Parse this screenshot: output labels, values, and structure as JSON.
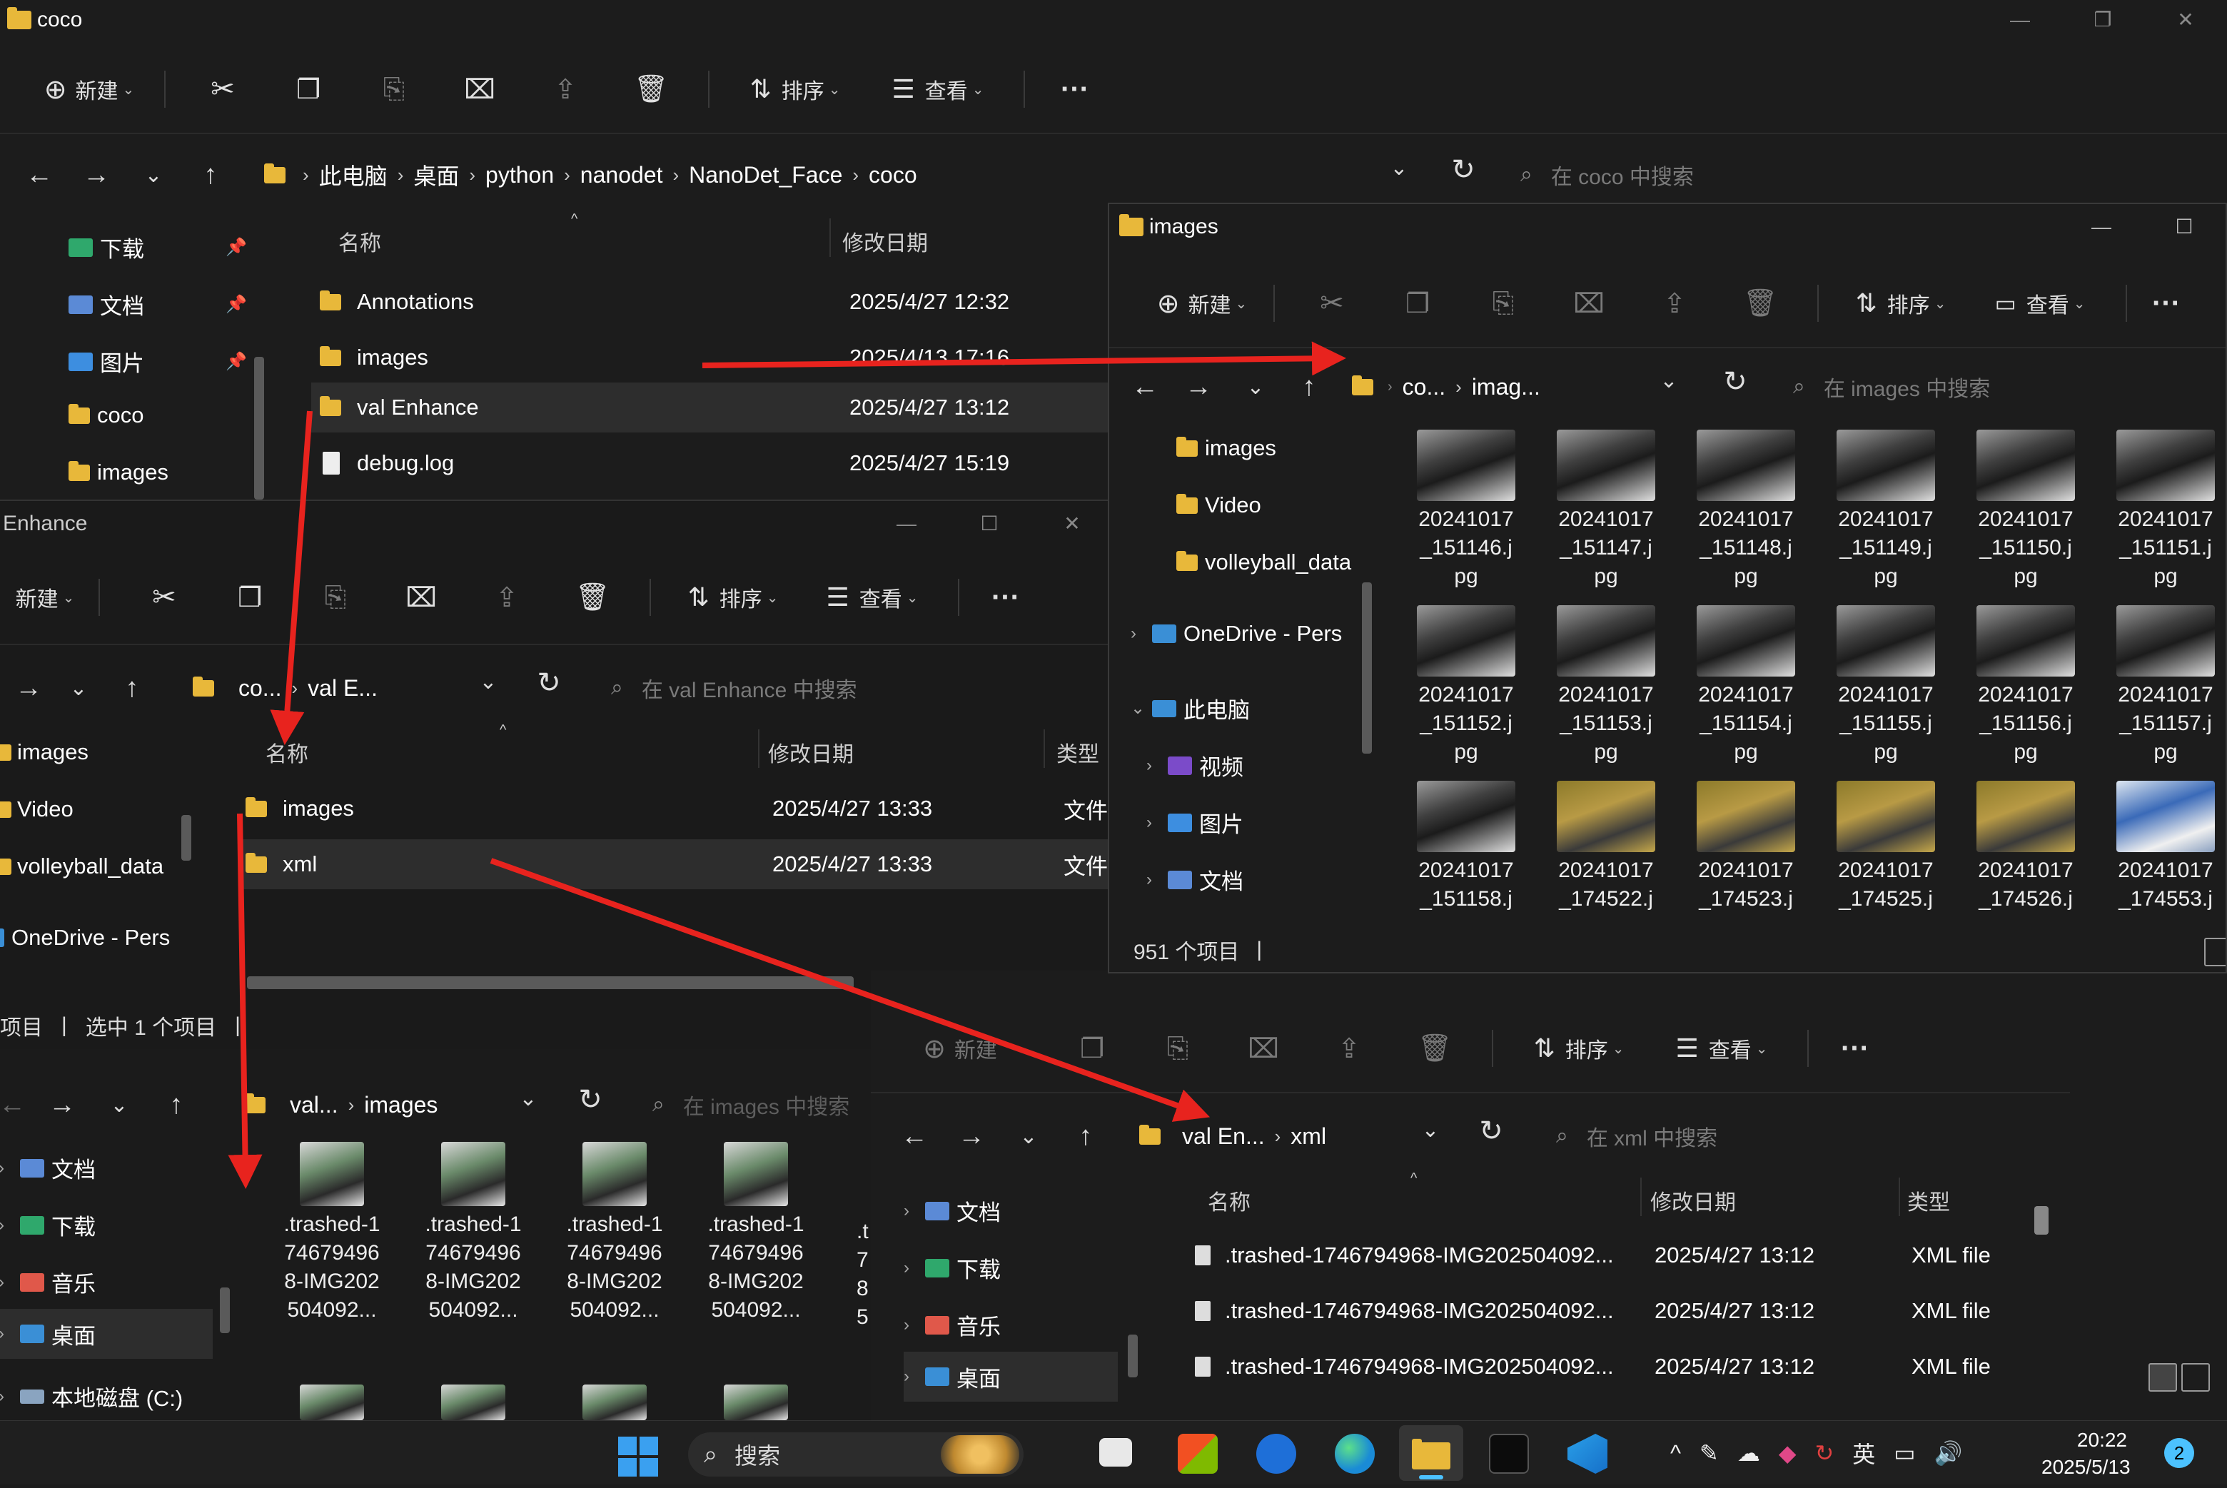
{
  "main_window": {
    "title": "coco",
    "toolbar": {
      "new": "新建",
      "sort": "排序",
      "view": "查看",
      "more": "···"
    },
    "breadcrumb": [
      "此电脑",
      "桌面",
      "python",
      "nanodet",
      "NanoDet_Face",
      "coco"
    ],
    "search_placeholder": "在 coco 中搜索",
    "nav": [
      {
        "label": "下载",
        "pinned": true
      },
      {
        "label": "文档",
        "pinned": true
      },
      {
        "label": "图片",
        "pinned": true
      },
      {
        "label": "coco"
      },
      {
        "label": "images"
      }
    ],
    "columns": {
      "name": "名称",
      "date": "修改日期"
    },
    "files": [
      {
        "name": "Annotations",
        "date": "2025/4/27 12:32",
        "type": "folder"
      },
      {
        "name": "images",
        "date": "2025/4/13 17:16",
        "type": "folder"
      },
      {
        "name": "val Enhance",
        "date": "2025/4/27 13:12",
        "type": "folder",
        "selected": true
      },
      {
        "name": "debug.log",
        "date": "2025/4/27 15:19",
        "type": "file"
      }
    ]
  },
  "enhance_window": {
    "title": "Enhance",
    "toolbar": {
      "new": "新建",
      "sort": "排序",
      "view": "查看",
      "more": "···"
    },
    "breadcrumb": [
      "co...",
      "val E..."
    ],
    "search_placeholder": "在 val Enhance 中搜索",
    "nav": [
      "images",
      "Video",
      "volleyball_data",
      "OneDrive - Pers"
    ],
    "columns": {
      "name": "名称",
      "date": "修改日期",
      "type": "类型"
    },
    "files": [
      {
        "name": "images",
        "date": "2025/4/27 13:33",
        "type": "文件"
      },
      {
        "name": "xml",
        "date": "2025/4/27 13:33",
        "type": "文件",
        "selected": true
      }
    ],
    "status": {
      "items": "项目",
      "selected": "选中 1 个项目"
    }
  },
  "images_window": {
    "title": "images",
    "toolbar": {
      "new": "新建",
      "sort": "排序",
      "view": "查看",
      "more": "···"
    },
    "breadcrumb": [
      "co...",
      "imag..."
    ],
    "search_placeholder": "在 images 中搜索",
    "nav": [
      {
        "label": "images",
        "indent": 1
      },
      {
        "label": "Video",
        "indent": 1
      },
      {
        "label": "volleyball_data",
        "indent": 1
      },
      {
        "label": "OneDrive - Pers",
        "indent": 0,
        "expander": "›"
      },
      {
        "label": "此电脑",
        "indent": 0,
        "expander": "⌄"
      },
      {
        "label": "视频",
        "indent": 1,
        "expander": "›"
      },
      {
        "label": "图片",
        "indent": 1,
        "expander": "›"
      },
      {
        "label": "文档",
        "indent": 1,
        "expander": "›"
      }
    ],
    "thumbs": [
      {
        "l1": "20241017",
        "l2": "_151146.j",
        "l3": "pg"
      },
      {
        "l1": "20241017",
        "l2": "_151147.j",
        "l3": "pg"
      },
      {
        "l1": "20241017",
        "l2": "_151148.j",
        "l3": "pg"
      },
      {
        "l1": "20241017",
        "l2": "_151149.j",
        "l3": "pg"
      },
      {
        "l1": "20241017",
        "l2": "_151150.j",
        "l3": "pg"
      },
      {
        "l1": "20241017",
        "l2": "_151151.j",
        "l3": "pg"
      },
      {
        "l1": "20241017",
        "l2": "_151152.j",
        "l3": "pg"
      },
      {
        "l1": "20241017",
        "l2": "_151153.j",
        "l3": "pg"
      },
      {
        "l1": "20241017",
        "l2": "_151154.j",
        "l3": "pg"
      },
      {
        "l1": "20241017",
        "l2": "_151155.j",
        "l3": "pg"
      },
      {
        "l1": "20241017",
        "l2": "_151156.j",
        "l3": "pg"
      },
      {
        "l1": "20241017",
        "l2": "_151157.j",
        "l3": "pg"
      },
      {
        "l1": "20241017",
        "l2": "_151158.j",
        "l3": ""
      },
      {
        "l1": "20241017",
        "l2": "_174522.j",
        "l3": ""
      },
      {
        "l1": "20241017",
        "l2": "_174523.j",
        "l3": ""
      },
      {
        "l1": "20241017",
        "l2": "_174525.j",
        "l3": ""
      },
      {
        "l1": "20241017",
        "l2": "_174526.j",
        "l3": ""
      },
      {
        "l1": "20241017",
        "l2": "_174553.j",
        "l3": ""
      }
    ],
    "status": "951 个项目"
  },
  "val_images_window": {
    "breadcrumb": [
      "val...",
      "images"
    ],
    "search_placeholder": "在 images 中搜索",
    "nav": [
      "文档",
      "下载",
      "音乐",
      "桌面",
      "本地磁盘 (C:)"
    ],
    "thumbs": [
      {
        "l1": ".trashed-1",
        "l2": "74679496",
        "l3": "8-IMG202",
        "l4": "504092..."
      },
      {
        "l1": ".trashed-1",
        "l2": "74679496",
        "l3": "8-IMG202",
        "l4": "504092..."
      },
      {
        "l1": ".trashed-1",
        "l2": "74679496",
        "l3": "8-IMG202",
        "l4": "504092..."
      },
      {
        "l1": ".trashed-1",
        "l2": "74679496",
        "l3": "8-IMG202",
        "l4": "504092..."
      }
    ],
    "partial_col": {
      "l1": ".t",
      "l2": "7",
      "l3": "8",
      "l4": "5"
    }
  },
  "xml_window": {
    "toolbar": {
      "new": "新建",
      "sort": "排序",
      "view": "查看",
      "more": "···"
    },
    "breadcrumb": [
      "val En...",
      "xml"
    ],
    "search_placeholder": "在 xml 中搜索",
    "nav": [
      "文档",
      "下载",
      "音乐",
      "桌面"
    ],
    "columns": {
      "name": "名称",
      "date": "修改日期",
      "type": "类型"
    },
    "files": [
      {
        "name": ".trashed-1746794968-IMG202504092...",
        "date": "2025/4/27 13:12",
        "type": "XML file"
      },
      {
        "name": ".trashed-1746794968-IMG202504092...",
        "date": "2025/4/27 13:12",
        "type": "XML file"
      },
      {
        "name": ".trashed-1746794968-IMG202504092...",
        "date": "2025/4/27 13:12",
        "type": "XML file"
      }
    ]
  },
  "taskbar": {
    "search": "搜索",
    "ime": "英",
    "time": "20:22",
    "date": "2025/5/13",
    "notifications": "2"
  },
  "colors": {
    "arrow": "#e8231e",
    "folder": "#e8b83a",
    "bg": "#191919",
    "selected_row": "#2d2d2d"
  }
}
